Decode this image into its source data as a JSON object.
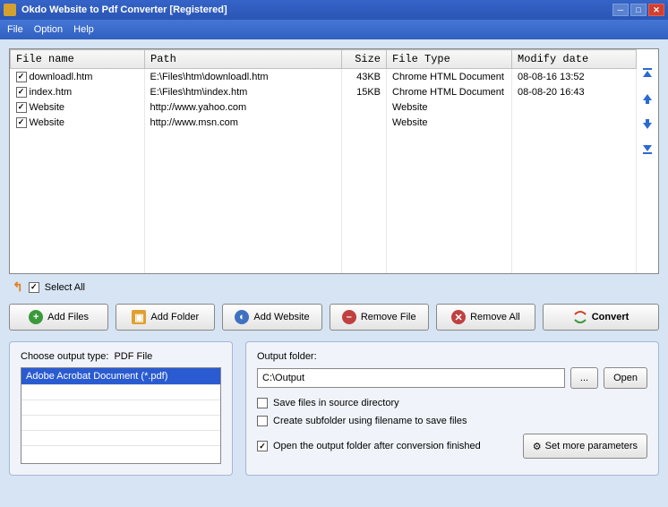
{
  "title": "Okdo Website to Pdf Converter [Registered]",
  "menu": {
    "file": "File",
    "option": "Option",
    "help": "Help"
  },
  "table": {
    "headers": {
      "name": "File name",
      "path": "Path",
      "size": "Size",
      "type": "File Type",
      "modify": "Modify date"
    },
    "rows": [
      {
        "name": "downloadl.htm",
        "path": "E:\\Files\\htm\\downloadl.htm",
        "size": "43KB",
        "type": "Chrome HTML Document",
        "modify": "08-08-16 13:52"
      },
      {
        "name": "index.htm",
        "path": "E:\\Files\\htm\\index.htm",
        "size": "15KB",
        "type": "Chrome HTML Document",
        "modify": "08-08-20 16:43"
      },
      {
        "name": "Website",
        "path": "http://www.yahoo.com",
        "size": "",
        "type": "Website",
        "modify": ""
      },
      {
        "name": "Website",
        "path": "http://www.msn.com",
        "size": "",
        "type": "Website",
        "modify": ""
      }
    ]
  },
  "selectAll": "Select All",
  "buttons": {
    "addFiles": "Add Files",
    "addFolder": "Add Folder",
    "addWebsite": "Add Website",
    "removeFile": "Remove File",
    "removeAll": "Remove All",
    "convert": "Convert"
  },
  "output": {
    "chooseLabel": "Choose output type:",
    "typeValue": "PDF File",
    "listItem": "Adobe Acrobat Document (*.pdf)",
    "folderLabel": "Output folder:",
    "folderValue": "C:\\Output",
    "browse": "...",
    "open": "Open",
    "saveSource": "Save files in source directory",
    "createSub": "Create subfolder using filename to save files",
    "openAfter": "Open the output folder after conversion finished",
    "moreParams": "Set more parameters"
  }
}
